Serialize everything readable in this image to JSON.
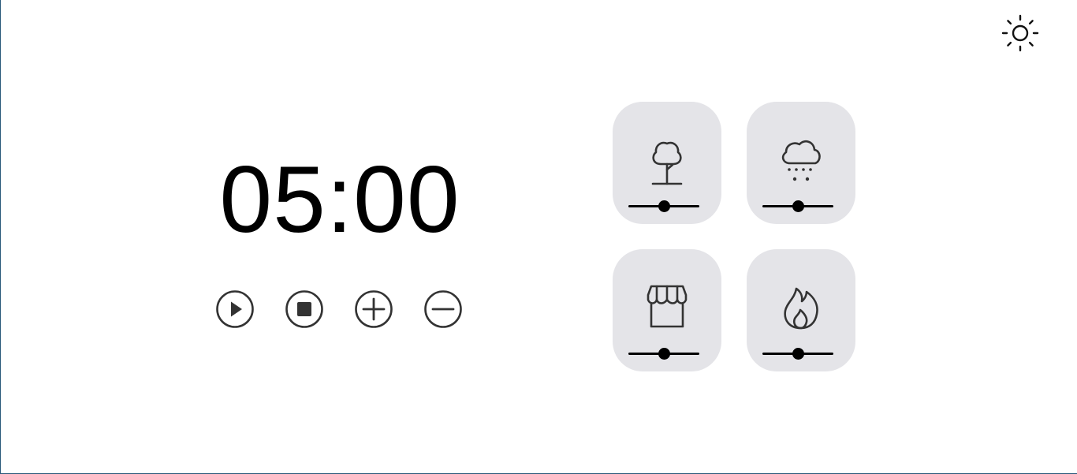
{
  "timer": {
    "display": "05:00"
  },
  "controls": [
    {
      "name": "play-button",
      "icon": "play-icon"
    },
    {
      "name": "stop-button",
      "icon": "stop-icon"
    },
    {
      "name": "increase-time-button",
      "icon": "plus-icon"
    },
    {
      "name": "decrease-time-button",
      "icon": "minus-icon"
    }
  ],
  "theme_toggle": {
    "icon": "sun-icon"
  },
  "sounds": [
    {
      "name": "forest",
      "icon": "tree-icon",
      "volume": 0.5
    },
    {
      "name": "rain",
      "icon": "rain-cloud-icon",
      "volume": 0.5
    },
    {
      "name": "coffee-shop",
      "icon": "storefront-icon",
      "volume": 0.5
    },
    {
      "name": "fireplace",
      "icon": "flame-icon",
      "volume": 0.5
    }
  ],
  "colors": {
    "card_background": "#e4e4e8",
    "icon_stroke": "#333333",
    "text": "#000000",
    "window_border": "#2a5a7a"
  }
}
